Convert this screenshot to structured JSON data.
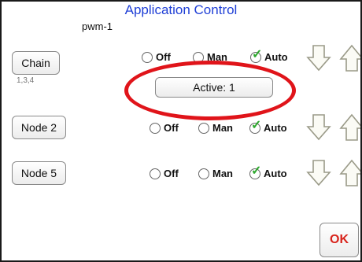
{
  "header": {
    "title": "Application Control",
    "pwm_label": "pwm-1"
  },
  "rows": [
    {
      "name": "Chain",
      "sub_label": "1,3,4",
      "options": [
        {
          "label": "Off"
        },
        {
          "label": "Man"
        },
        {
          "label": "Auto"
        }
      ],
      "selected": "Auto",
      "status": "Active: 1"
    },
    {
      "name": "Node 2",
      "options": [
        {
          "label": "Off"
        },
        {
          "label": "Man"
        },
        {
          "label": "Auto"
        }
      ],
      "selected": "Auto"
    },
    {
      "name": "Node 5",
      "options": [
        {
          "label": "Off"
        },
        {
          "label": "Man"
        },
        {
          "label": "Auto"
        }
      ],
      "selected": "Auto"
    }
  ],
  "footer": {
    "ok_label": "OK"
  },
  "colors": {
    "title": "#1f3fd6",
    "check": "#2ea82e",
    "highlight": "#e0141a",
    "ok_text": "#d8231b"
  },
  "icons": {
    "down": "down-arrow-icon",
    "up": "up-arrow-icon",
    "check": "checkmark-icon"
  }
}
